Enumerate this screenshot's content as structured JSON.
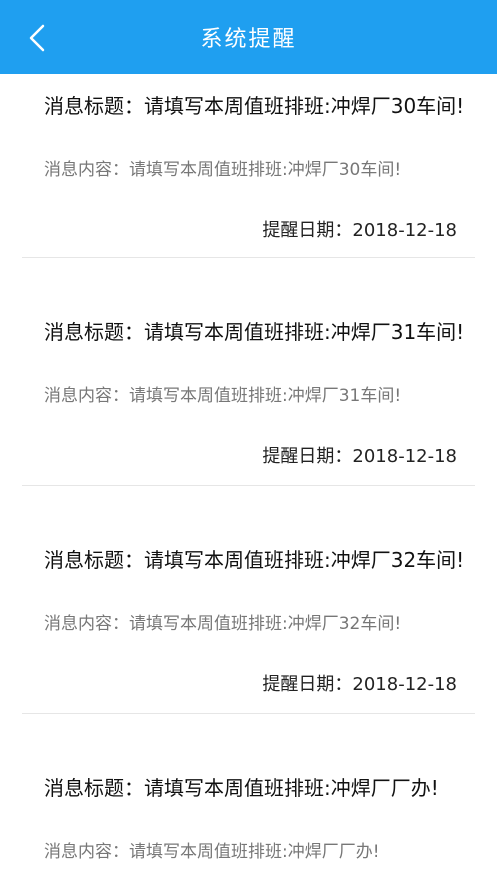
{
  "header": {
    "title": "系统提醒",
    "back_icon": "chevron-left-icon",
    "background_color": "#1f9ff0"
  },
  "messages": [
    {
      "title_prefix": "消息标题：",
      "title": "请填写本周值班排班:冲焊厂30车间!",
      "content_prefix": "消息内容：",
      "content": "请填写本周值班排班:冲焊厂30车间!",
      "date_prefix": "提醒日期：",
      "date": "2018-12-18"
    },
    {
      "title_prefix": "消息标题：",
      "title": "请填写本周值班排班:冲焊厂31车间!",
      "content_prefix": "消息内容：",
      "content": "请填写本周值班排班:冲焊厂31车间!",
      "date_prefix": "提醒日期：",
      "date": "2018-12-18"
    },
    {
      "title_prefix": "消息标题：",
      "title": "请填写本周值班排班:冲焊厂32车间!",
      "content_prefix": "消息内容：",
      "content": "请填写本周值班排班:冲焊厂32车间!",
      "date_prefix": "提醒日期：",
      "date": "2018-12-18"
    },
    {
      "title_prefix": "消息标题：",
      "title": "请填写本周值班排班:冲焊厂厂办!",
      "content_prefix": "消息内容：",
      "content": "请填写本周值班排班:冲焊厂厂办!"
    }
  ]
}
